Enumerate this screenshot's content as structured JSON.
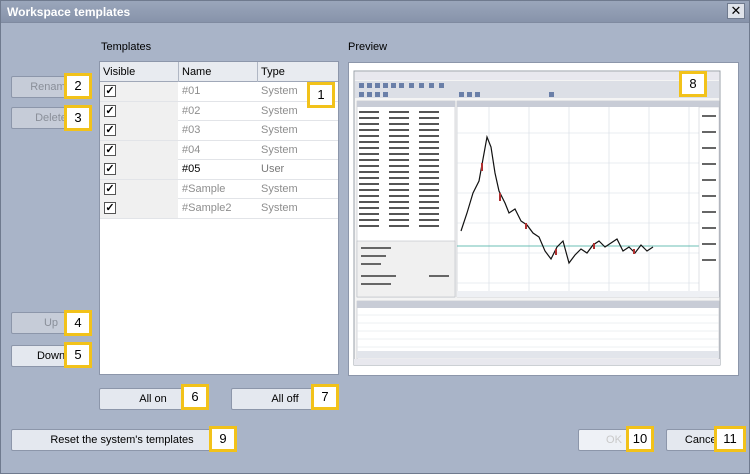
{
  "window": {
    "title": "Workspace templates",
    "close_glyph": "✕"
  },
  "templates_label": "Templates",
  "preview_label": "Preview",
  "table": {
    "headers": {
      "visible": "Visible",
      "name": "Name",
      "type": "Type"
    },
    "rows": [
      {
        "name": "#01",
        "type": "System",
        "checked": true
      },
      {
        "name": "#02",
        "type": "System",
        "checked": true
      },
      {
        "name": "#03",
        "type": "System",
        "checked": true
      },
      {
        "name": "#04",
        "type": "System",
        "checked": true
      },
      {
        "name": "#05",
        "type": "User",
        "checked": true
      },
      {
        "name": "#Sample",
        "type": "System",
        "checked": true
      },
      {
        "name": "#Sample2",
        "type": "System",
        "checked": true
      }
    ]
  },
  "buttons": {
    "rename": "Rename",
    "delete": "Delete",
    "up": "Up",
    "down": "Down",
    "all_on": "All on",
    "all_off": "All off",
    "reset": "Reset the system's templates",
    "ok": "OK",
    "cancel": "Cancel"
  },
  "badges": {
    "b1": "1",
    "b2": "2",
    "b3": "3",
    "b4": "4",
    "b5": "5",
    "b6": "6",
    "b7": "7",
    "b8": "8",
    "b9": "9",
    "b10": "10",
    "b11": "11"
  },
  "colors": {
    "badge_border": "#f2c21a",
    "window_bg": "#a9b4c8",
    "title_bg": "#8793aa"
  }
}
